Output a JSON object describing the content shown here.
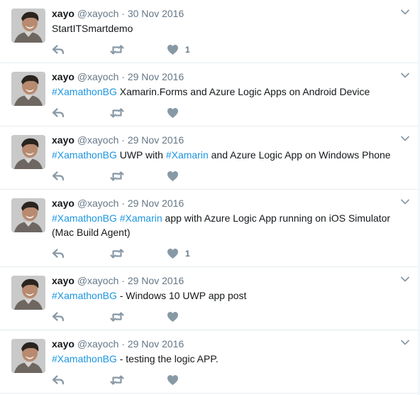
{
  "tweets": [
    {
      "name": "xayo",
      "handle": "@xayoch",
      "dot": "·",
      "date": "30 Nov 2016",
      "text": [
        {
          "t": "StartITSmartdemo",
          "h": false
        }
      ],
      "likes": "1"
    },
    {
      "name": "xayo",
      "handle": "@xayoch",
      "dot": "·",
      "date": "29 Nov 2016",
      "text": [
        {
          "t": "#XamathonBG",
          "h": true
        },
        {
          "t": " Xamarin.Forms and Azure Logic Apps on Android Device",
          "h": false
        }
      ],
      "likes": ""
    },
    {
      "name": "xayo",
      "handle": "@xayoch",
      "dot": "·",
      "date": "29 Nov 2016",
      "text": [
        {
          "t": "#XamathonBG",
          "h": true
        },
        {
          "t": " UWP with ",
          "h": false
        },
        {
          "t": "#Xamarin",
          "h": true
        },
        {
          "t": " and Azure Logic App on Windows Phone",
          "h": false
        }
      ],
      "likes": ""
    },
    {
      "name": "xayo",
      "handle": "@xayoch",
      "dot": "·",
      "date": "29 Nov 2016",
      "text": [
        {
          "t": "#XamathonBG",
          "h": true
        },
        {
          "t": " ",
          "h": false
        },
        {
          "t": "#Xamarin",
          "h": true
        },
        {
          "t": " app with Azure Logic App running on iOS Simulator (Mac Build Agent)",
          "h": false
        }
      ],
      "likes": "1"
    },
    {
      "name": "xayo",
      "handle": "@xayoch",
      "dot": "·",
      "date": "29 Nov 2016",
      "text": [
        {
          "t": "#XamathonBG",
          "h": true
        },
        {
          "t": " - Windows 10 UWP app post",
          "h": false
        }
      ],
      "likes": ""
    },
    {
      "name": "xayo",
      "handle": "@xayoch",
      "dot": "·",
      "date": "29 Nov 2016",
      "text": [
        {
          "t": "#XamathonBG",
          "h": true
        },
        {
          "t": " - testing the logic APP.",
          "h": false
        }
      ],
      "likes": ""
    }
  ],
  "icons": {
    "reply": "reply-icon",
    "retweet": "retweet-icon",
    "like": "heart-icon",
    "caret": "chevron-down-icon",
    "avatar": "avatar"
  },
  "colors": {
    "hashtag": "#1b95e0",
    "icon": "#8899a6",
    "meta": "#657786",
    "divider": "#e6ecf0"
  }
}
